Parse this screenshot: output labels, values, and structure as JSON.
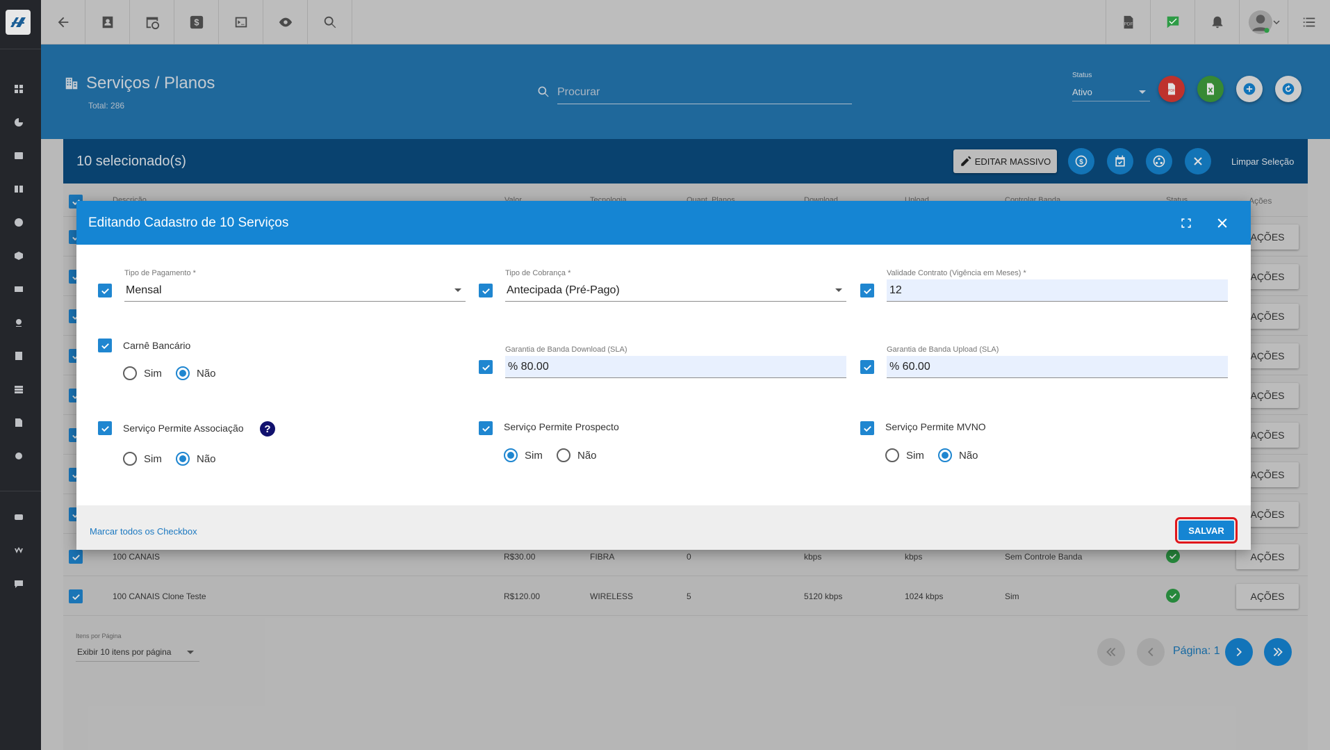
{
  "topbar": {
    "left_icons": [
      "back-arrow-icon",
      "contact-card-icon",
      "clock-calendar-icon",
      "dollar-icon",
      "terminal-icon",
      "eye-icon",
      "search-icon"
    ],
    "right_icons": [
      "pdf-icon",
      "chat-check-icon",
      "bell-icon",
      "user-avatar",
      "list-menu-icon"
    ]
  },
  "sidebar": {
    "icons": [
      "dashboard-icon",
      "chart-pie-icon",
      "contact-card-icon",
      "book-icon",
      "clock-calendar-icon",
      "box-icon",
      "money-icon",
      "location-pin-icon",
      "list-icon",
      "server-icon",
      "document-icon",
      "gear-icon",
      "video-icon",
      "wordpress-icon",
      "message-icon"
    ]
  },
  "header": {
    "title": "Serviços / Planos",
    "total": "Total: 286",
    "search_placeholder": "Procurar",
    "status_label": "Status",
    "status_value": "Ativo",
    "colors": {
      "header_bg": "#2477b1",
      "pdf": "#d93a34",
      "excel": "#3f9c3c",
      "accent": "#1585d3"
    }
  },
  "selection": {
    "count_label": "10 selecionado(s)",
    "edit_massivo": "EDITAR MASSIVO",
    "limpar": "Limpar Seleção"
  },
  "table": {
    "headers": [
      "Descrição",
      "Valor",
      "Tecnologia",
      "Quant. Planos",
      "Download",
      "Upload",
      "Controlar Banda",
      "Status",
      "Ações"
    ],
    "action_label": "AÇÕES",
    "rows": [
      {
        "descricao": "100 CANAIS",
        "valor": "R$30.00",
        "tecnologia": "FIBRA",
        "planos": "0",
        "download": "kbps",
        "upload": "kbps",
        "banda": "Sem Controle Banda"
      },
      {
        "descricao": "100 CANAIS Clone Teste",
        "valor": "R$120.00",
        "tecnologia": "WIRELESS",
        "planos": "5",
        "download": "5120 kbps",
        "upload": "1024 kbps",
        "banda": "Sim"
      }
    ]
  },
  "pagination": {
    "per_page_label": "Itens por Página",
    "per_page_value": "Exibir 10 itens por página",
    "page_label": "Página: 1"
  },
  "modal": {
    "title": "Editando Cadastro de 10 Serviços",
    "fields": {
      "tipo_pagamento": {
        "label": "Tipo de Pagamento *",
        "value": "Mensal"
      },
      "tipo_cobranca": {
        "label": "Tipo de Cobrança *",
        "value": "Antecipada (Pré-Pago)"
      },
      "validade": {
        "label": "Validade Contrato (Vigência em Meses) *",
        "value": "12"
      },
      "garantia_download": {
        "label": "Garantia de Banda Download (SLA)",
        "value": "% 80.00"
      },
      "garantia_upload": {
        "label": "Garantia de Banda Upload (SLA)",
        "value": "% 60.00"
      }
    },
    "groups": {
      "carne": {
        "label": "Carnê Bancário",
        "sim": "Sim",
        "nao": "Não",
        "selected": "nao"
      },
      "associacao": {
        "label": "Serviço Permite Associação",
        "sim": "Sim",
        "nao": "Não",
        "selected": "nao"
      },
      "prospecto": {
        "label": "Serviço Permite Prospecto",
        "sim": "Sim",
        "nao": "Não",
        "selected": "sim"
      },
      "mvno": {
        "label": "Serviço Permite MVNO",
        "sim": "Sim",
        "nao": "Não",
        "selected": "nao"
      }
    },
    "help": "?",
    "marcar_todos": "Marcar todos os Checkbox",
    "salvar": "SALVAR"
  }
}
